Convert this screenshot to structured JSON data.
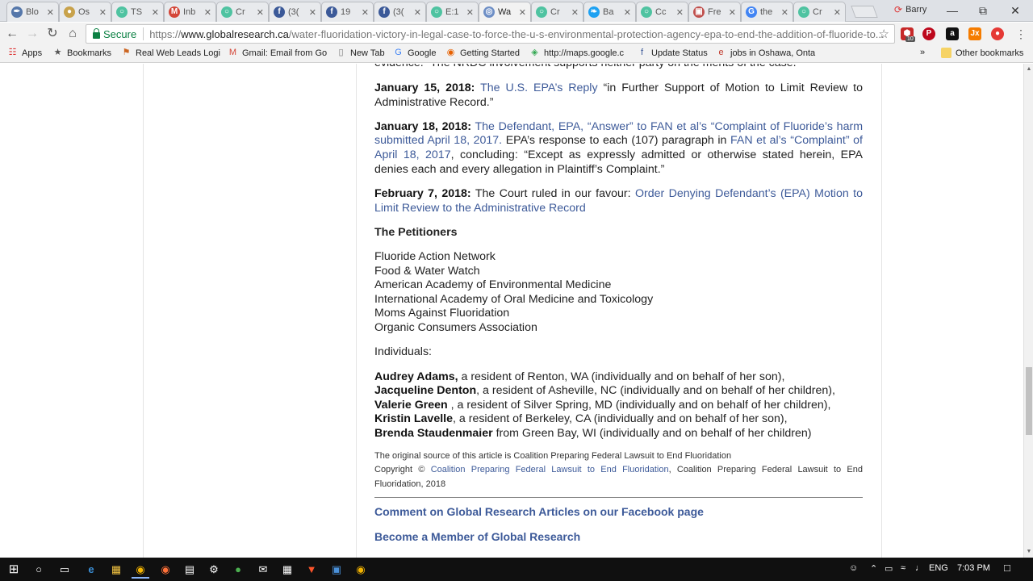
{
  "tabs": [
    {
      "label": "Blo",
      "icon": "feather-icon",
      "color": "#5577aa"
    },
    {
      "label": "Os",
      "icon": "circle-icon",
      "color": "#c8a24b"
    },
    {
      "label": "TS",
      "icon": "teal-circle-icon",
      "color": "#4fc3a1"
    },
    {
      "label": "Inb",
      "icon": "gmail-icon",
      "color": "#d44638"
    },
    {
      "label": "Cr",
      "icon": "teal-circle-icon",
      "color": "#4fc3a1"
    },
    {
      "label": "(3(",
      "icon": "facebook-icon",
      "color": "#3b5998"
    },
    {
      "label": "19",
      "icon": "facebook-icon",
      "color": "#3b5998"
    },
    {
      "label": "(3(",
      "icon": "facebook-icon",
      "color": "#3b5998"
    },
    {
      "label": "E:1",
      "icon": "teal-circle-icon",
      "color": "#4fc3a1"
    },
    {
      "label": "Wa",
      "icon": "globe-icon",
      "color": "#6e8fc6"
    },
    {
      "label": "Cr",
      "icon": "teal-circle-icon",
      "color": "#4fc3a1"
    },
    {
      "label": "Ba",
      "icon": "twitter-icon",
      "color": "#1da1f2"
    },
    {
      "label": "Cc",
      "icon": "teal-circle-icon",
      "color": "#4fc3a1"
    },
    {
      "label": "Fre",
      "icon": "image-icon",
      "color": "#c0504d"
    },
    {
      "label": "the",
      "icon": "google-icon",
      "color": "#4285f4"
    },
    {
      "label": "Cr",
      "icon": "teal-circle-icon",
      "color": "#4fc3a1"
    }
  ],
  "profile_name": "Barry",
  "omnibox": {
    "secure_label": "Secure",
    "url_scheme": "https://",
    "url_host": "www.globalresearch.ca",
    "url_path": "/water-fluoridation-victory-in-legal-case-to-force-the-u-s-environmental-protection-agency-epa-to-end-the-addition-of-fluoride-to..."
  },
  "extensions": {
    "abp_badge": "10"
  },
  "bookmarks": [
    {
      "label": "Apps",
      "icon": "apps-grid-icon"
    },
    {
      "label": "Bookmarks",
      "icon": "star-icon"
    },
    {
      "label": "Real Web Leads Logi",
      "icon": "leads-icon"
    },
    {
      "label": "Gmail: Email from Go",
      "icon": "gmail-icon"
    },
    {
      "label": "New Tab",
      "icon": "page-icon"
    },
    {
      "label": "Google",
      "icon": "google-icon"
    },
    {
      "label": "Getting Started",
      "icon": "firefox-icon"
    },
    {
      "label": "http://maps.google.c",
      "icon": "maps-icon"
    },
    {
      "label": "Update Status",
      "icon": "facebook-icon"
    },
    {
      "label": "jobs in Oshawa, Onta",
      "icon": "e-icon"
    }
  ],
  "other_bookmarks": "Other bookmarks",
  "article": {
    "clipped_top": "evidence.” The NRDC involvement supports neither party on the merits of the case.",
    "entries": [
      {
        "date": "January 15, 2018:",
        "link1": "The U.S. EPA’s Reply",
        "text1": " “in Further Support of Motion to Limit Review to Administrative Record.”"
      },
      {
        "date": "January 18, 2018:",
        "link1": "The Defendant, EPA, “Answer” to FAN et al’s “Complaint of Fluoride’s harm submitted April 18, 2017.",
        "text1": " EPA’s response to each (107) paragraph in ",
        "link2": "FAN et al’s “Complaint” of April 18, 2017",
        "text2": ", concluding: “Except as expressly admitted or otherwise stated herein, EPA denies each and every allegation in Plaintiff’s Complaint.”"
      },
      {
        "date": "February 7, 2018:",
        "text0": " The Court ruled in our favour: ",
        "link1": "Order Denying Defendant’s (EPA) Motion to Limit Review to the Administrative Record"
      }
    ],
    "petitioners_heading": "The Petitioners",
    "petitioners": [
      "Fluoride Action Network",
      "Food & Water Watch",
      "American Academy of Environmental Medicine",
      "International Academy of Oral Medicine and Toxicology",
      "Moms Against Fluoridation",
      "Organic Consumers Association"
    ],
    "individuals_heading": "Individuals:",
    "individuals": [
      {
        "name": "Audrey Adams,",
        "detail": " a resident of Renton, WA (individually and on behalf of her son),"
      },
      {
        "name": "Jacqueline Denton",
        "detail": ", a resident of Asheville, NC (individually and on behalf of her children),"
      },
      {
        "name": "Valerie Green",
        "detail": " , a resident of Silver Spring, MD (individually and on behalf of her children),"
      },
      {
        "name": "Kristin Lavelle",
        "detail": ", a resident of Berkeley, CA (individually and on behalf of her son),"
      },
      {
        "name": "Brenda Staudenmaier",
        "detail": " from Green Bay, WI (individually and on behalf of her children)"
      }
    ],
    "source_line": "The original source of this article is Coalition Preparing Federal Lawsuit to End Fluoridation",
    "copyright_prefix": "Copyright © ",
    "copyright_link": "Coalition Preparing Federal Lawsuit to End Fluoridation",
    "copyright_suffix": ", Coalition Preparing Federal Lawsuit to End Fluoridation, 2018",
    "cta_facebook": "Comment on Global Research Articles on our Facebook page",
    "cta_member": "Become a Member of Global Research"
  },
  "taskbar": {
    "lang": "ENG",
    "time": "7:03 PM"
  },
  "colors": {
    "link": "#3d5a99",
    "secure": "#0b8043",
    "taskbar": "#101010"
  }
}
